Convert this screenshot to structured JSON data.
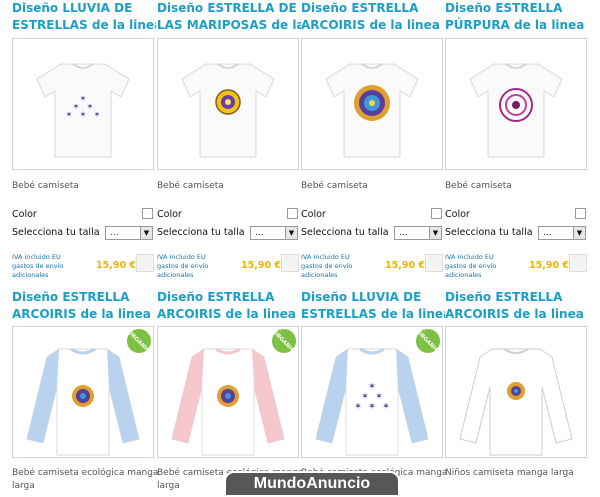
{
  "products": [
    {
      "title_line1": "Diseño LLUVIA DE",
      "title_line2": "ESTRELLAS de la linea",
      "subtitle": "Bebé camiseta",
      "color_label": "Color",
      "size_label": "Selecciona tu talla",
      "size_value": "...",
      "iva_line1": "IVA incluido EU",
      "iva_line2": "gastos de envío",
      "iva_line3": "adicionales",
      "price": "15,90 €"
    },
    {
      "title_line1": "Diseño ESTRELLA DE",
      "title_line2": "LAS MARIPOSAS de la",
      "subtitle": "Bebé camiseta",
      "color_label": "Color",
      "size_label": "Selecciona tu talla",
      "size_value": "...",
      "iva_line1": "IVA incluido EU",
      "iva_line2": "gastos de envío",
      "iva_line3": "adicionales",
      "price": "15,90 €"
    },
    {
      "title_line1": "Diseño ESTRELLA",
      "title_line2": "ARCOIRIS de la linea \"",
      "subtitle": "Bebé camiseta",
      "color_label": "Color",
      "size_label": "Selecciona tu talla",
      "size_value": "...",
      "iva_line1": "IVA incluido EU",
      "iva_line2": "gastos de envío",
      "iva_line3": "adicionales",
      "price": "15,90 €"
    },
    {
      "title_line1": "Diseño ESTRELLA",
      "title_line2": "PÚRPURA de la linea \"",
      "subtitle": "Bebé camiseta",
      "color_label": "Color",
      "size_label": "Selecciona tu talla",
      "size_value": "...",
      "iva_line1": "IVA incluido EU",
      "iva_line2": "gastos de envío",
      "iva_line3": "adicionales",
      "price": "15,90 €"
    },
    {
      "title_line1": "Diseño ESTRELLA",
      "title_line2": "ARCOIRIS de la linea \"",
      "subtitle_line1": "Bebé camiseta ecológica manga",
      "subtitle_line2": "larga",
      "badge": "ORGANIC"
    },
    {
      "title_line1": "Diseño ESTRELLA",
      "title_line2": "ARCOIRIS de la linea \"",
      "subtitle_line1": "Bebé camiseta ecológica manga",
      "subtitle_line2": "larga",
      "badge": "ORGANIC"
    },
    {
      "title_line1": "Diseño LLUVIA DE",
      "title_line2": "ESTRELLAS de la linea",
      "subtitle_line1": "Bebé camiseta ecológica manga",
      "subtitle_line2": "larga",
      "badge": "ORGANIC"
    },
    {
      "title_line1": "Diseño ESTRELLA",
      "title_line2": "ARCOIRIS de la linea \"",
      "subtitle_line1": "Niños camiseta manga larga",
      "subtitle_line2": ""
    }
  ],
  "watermark": "MundoAnuncio",
  "colors": {
    "title": "#1a9fc6",
    "price": "#f0b400",
    "organic": "#7cc142",
    "sleeve_blue": "#b9d3ee",
    "sleeve_pink": "#f5c7cc"
  }
}
